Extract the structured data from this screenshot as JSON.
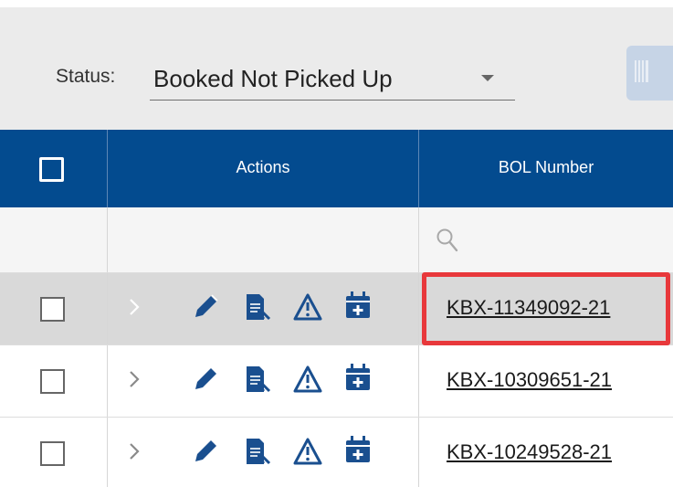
{
  "filter": {
    "label": "Status:",
    "value": "Booked Not Picked Up"
  },
  "table": {
    "columns": {
      "actions": "Actions",
      "bol": "BOL Number"
    },
    "rows": [
      {
        "bol": "KBX-11349092-21",
        "selected": true
      },
      {
        "bol": "KBX-10309651-21",
        "selected": false
      },
      {
        "bol": "KBX-10249528-21",
        "selected": false
      }
    ]
  },
  "icons": {
    "expand": "chevron-right-icon",
    "edit": "pencil-icon",
    "document": "document-icon",
    "alert": "warning-triangle-icon",
    "schedule": "calendar-plus-icon",
    "search": "search-icon",
    "barcode": "barcode-icon"
  },
  "colors": {
    "header_bg": "#034b8f",
    "icon": "#1a4f8f",
    "highlight": "#e8383b",
    "selected_row": "#d9d9d9",
    "toolbar_bg": "#ebebeb"
  }
}
